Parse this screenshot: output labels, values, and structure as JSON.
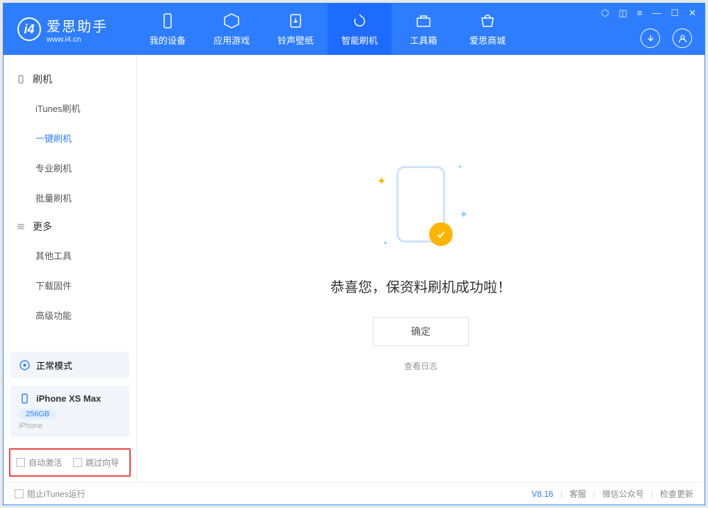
{
  "app": {
    "name_cn": "爱思助手",
    "name_en": "www.i4.cn"
  },
  "tabs": [
    {
      "label": "我的设备"
    },
    {
      "label": "应用游戏"
    },
    {
      "label": "铃声壁纸"
    },
    {
      "label": "智能刷机"
    },
    {
      "label": "工具箱"
    },
    {
      "label": "爱思商城"
    }
  ],
  "sidebar": {
    "group1": {
      "title": "刷机",
      "items": [
        "iTunes刷机",
        "一键刷机",
        "专业刷机",
        "批量刷机"
      ]
    },
    "group2": {
      "title": "更多",
      "items": [
        "其他工具",
        "下载固件",
        "高级功能"
      ]
    },
    "mode": "正常模式",
    "device": {
      "name": "iPhone XS Max",
      "capacity": "256GB",
      "type": "iPhone"
    },
    "checks": {
      "auto_activate": "自动激活",
      "skip_guide": "跳过向导"
    }
  },
  "main": {
    "success": "恭喜您，保资料刷机成功啦！",
    "ok": "确定",
    "view_log": "查看日志"
  },
  "status": {
    "block_itunes": "阻止iTunes运行",
    "version": "V8.16",
    "support": "客服",
    "wechat": "微信公众号",
    "update": "检查更新"
  }
}
